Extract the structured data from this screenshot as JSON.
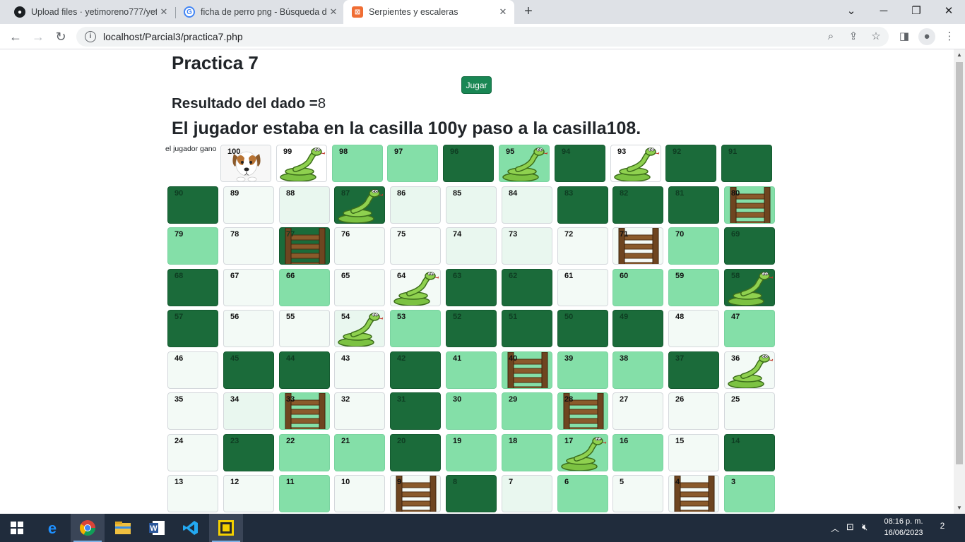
{
  "browser": {
    "tabs": [
      {
        "title": "Upload files · yetimoreno777/yeti",
        "favicon": "github-icon"
      },
      {
        "title": "ficha de perro png - Búsqueda de",
        "favicon": "google-icon"
      },
      {
        "title": "Serpientes y escaleras",
        "favicon": "xampp-icon",
        "active": true
      }
    ],
    "url": "localhost/Parcial3/practica7.php"
  },
  "page": {
    "title": "Practica 7",
    "play_button": "Jugar",
    "dice_label": "Resultado del dado =",
    "dice_value": "8",
    "move_message": "El jugador estaba en la casilla 100y paso a la casilla108.",
    "win_note": "el jugador gano"
  },
  "board": {
    "rows": [
      [
        100,
        99,
        98,
        97,
        96,
        95,
        94,
        93,
        92,
        91
      ],
      [
        90,
        89,
        88,
        87,
        86,
        85,
        84,
        83,
        82,
        81,
        80
      ],
      [
        79,
        78,
        77,
        76,
        75,
        74,
        73,
        72,
        71,
        70,
        69
      ],
      [
        68,
        67,
        66,
        65,
        64,
        63,
        62,
        61,
        60,
        59,
        58
      ],
      [
        57,
        56,
        55,
        54,
        53,
        52,
        51,
        50,
        49,
        48,
        47
      ],
      [
        46,
        45,
        44,
        43,
        42,
        41,
        40,
        39,
        38,
        37,
        36
      ],
      [
        35,
        34,
        33,
        32,
        31,
        30,
        29,
        28,
        27,
        26,
        25
      ],
      [
        24,
        23,
        22,
        21,
        20,
        19,
        18,
        17,
        16,
        15,
        14
      ],
      [
        13,
        12,
        11,
        10,
        9,
        8,
        7,
        6,
        5,
        4,
        3
      ]
    ],
    "colors": {
      "100": "plain",
      "99": "plain",
      "98": "mint",
      "97": "mint",
      "96": "dark",
      "95": "mint",
      "94": "dark",
      "93": "plain",
      "92": "dark",
      "91": "dark",
      "90": "dark",
      "89": "white",
      "88": "light",
      "87": "dark",
      "86": "light",
      "85": "light",
      "84": "light",
      "83": "dark",
      "82": "dark",
      "81": "dark",
      "80": "mint",
      "79": "mint",
      "78": "white",
      "77": "dark",
      "76": "white",
      "75": "white",
      "74": "light",
      "73": "light",
      "72": "white",
      "71": "white",
      "70": "mint",
      "69": "dark",
      "68": "dark",
      "67": "white",
      "66": "mint",
      "65": "white",
      "64": "white",
      "63": "dark",
      "62": "dark",
      "61": "white",
      "60": "mint",
      "59": "mint",
      "58": "dark",
      "57": "dark",
      "56": "white",
      "55": "white",
      "54": "light",
      "53": "mint",
      "52": "dark",
      "51": "dark",
      "50": "dark",
      "49": "dark",
      "48": "white",
      "47": "mint",
      "46": "white",
      "45": "dark",
      "44": "dark",
      "43": "white",
      "42": "dark",
      "41": "mint",
      "40": "mint",
      "39": "mint",
      "38": "mint",
      "37": "dark",
      "36": "white",
      "35": "white",
      "34": "light",
      "33": "mint",
      "32": "white",
      "31": "dark",
      "30": "mint",
      "29": "mint",
      "28": "mint",
      "27": "white",
      "26": "white",
      "25": "white",
      "24": "white",
      "23": "dark",
      "22": "mint",
      "21": "mint",
      "20": "dark",
      "19": "mint",
      "18": "mint",
      "17": "mint",
      "16": "mint",
      "15": "white",
      "14": "dark",
      "13": "white",
      "12": "white",
      "11": "mint",
      "10": "white",
      "9": "white",
      "8": "dark",
      "7": "light",
      "6": "mint",
      "5": "white",
      "4": "white",
      "3": "mint"
    },
    "snakes": [
      99,
      95,
      93,
      87,
      64,
      58,
      54,
      36,
      17
    ],
    "ladders": [
      80,
      77,
      71,
      40,
      33,
      28,
      9,
      4
    ],
    "player_cell": 100,
    "player_piece": "dog-icon"
  },
  "taskbar": {
    "time": "08:16 p. m.",
    "date": "16/06/2023",
    "notifications": "2",
    "apps": [
      "windows-start-icon",
      "edge-icon",
      "chrome-icon",
      "file-explorer-icon",
      "word-icon",
      "vscode-icon",
      "xampp-icon"
    ]
  }
}
